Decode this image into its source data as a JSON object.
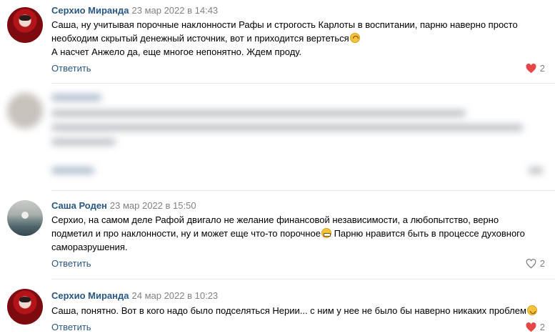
{
  "comments": [
    {
      "author": "Серхио Миранда",
      "date": "23 мар 2022 в 14:43",
      "lines": [
        "Саша, ну учитывая порочные наклонности Рафы и строгость Карлоты в воспитании, парню наверно просто",
        "необходим скрытый денежный источник, вот и приходится вертеться",
        "А насчет Анжело да, еще многое непонятно. Ждем проду."
      ],
      "reply_label": "Ответить",
      "likes": "2",
      "liked": true,
      "emoji": "upside-down-face-emoji"
    },
    {
      "author": "Саша Роден",
      "date": "23 мар 2022 в 15:50",
      "lines": [
        "Серхио, на самом деле Рафой двигало не желание финансовой независимости, а любопытство, верно",
        "подметил и про наклонности, ну и может еще что-то порочное",
        " Парню нравится быть в процессе духовного",
        "саморазрушения."
      ],
      "reply_label": "Ответить",
      "likes": "2",
      "liked": false,
      "emoji": "grinning-face-emoji"
    },
    {
      "author": "Серхио Миранда",
      "date": "24 мар 2022 в 10:23",
      "lines": [
        "Саша, понятно. Вот в кого надо было подселяться Нерии... с ним у нее не было бы наверно никаких проблем"
      ],
      "reply_label": "Ответить",
      "likes": "2",
      "liked": true,
      "emoji": "winking-face-emoji"
    }
  ],
  "colors": {
    "link": "#2a5885",
    "date": "#828282",
    "like_active": "#e64646",
    "divider": "#e7e8ec"
  },
  "icons": {
    "like_active": "heart-filled-icon",
    "like_inactive": "heart-outline-icon"
  }
}
